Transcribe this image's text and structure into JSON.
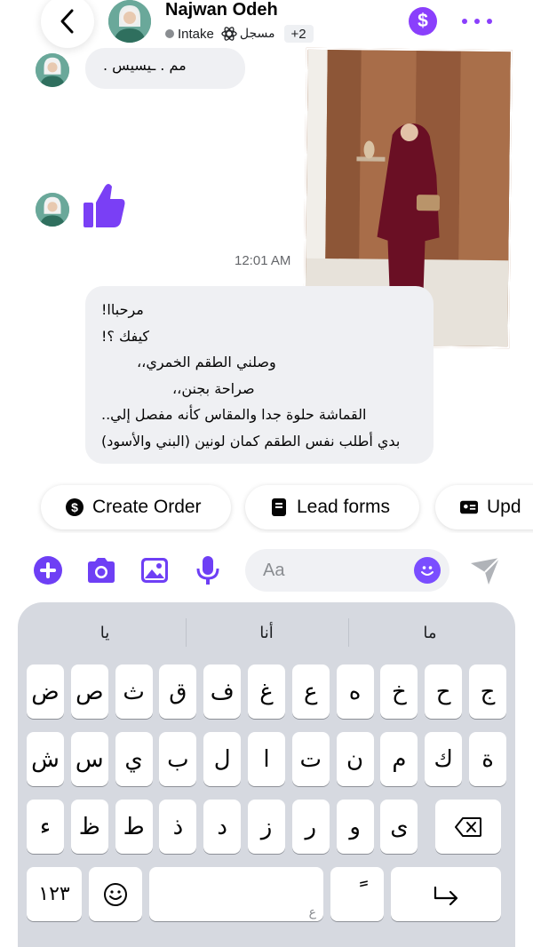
{
  "header": {
    "contact_name": "Najwan Odeh",
    "status_label": "Intake",
    "tag_label": "مسجل",
    "extra_tags": "+2",
    "dollar_glyph": "$"
  },
  "chat": {
    "top_bubble_text": "مم . ـيسيس .",
    "timestamp": "12:01 AM",
    "message_lines": [
      "مرحباا!",
      "كيفك ؟!",
      "وصلني الطقم الخمري،،",
      "صراحة بجنن،،",
      "القماشة حلوة جدا والمقاس كأنه مفصل إلي..",
      "بدي أطلب نفس الطقم كمان لونين (البني والأسود)"
    ]
  },
  "quick_actions": {
    "create_order": "Create Order",
    "lead_forms": "Lead forms",
    "update": "Upd"
  },
  "composer": {
    "placeholder": "Aa"
  },
  "keyboard": {
    "suggestions": [
      "يا",
      "أنا",
      "ما"
    ],
    "rows": [
      [
        "ض",
        "ص",
        "ث",
        "ق",
        "ف",
        "غ",
        "ع",
        "ه",
        "خ",
        "ح",
        "ج"
      ],
      [
        "ش",
        "س",
        "ي",
        "ب",
        "ل",
        "ا",
        "ت",
        "ن",
        "م",
        "ك",
        "ة"
      ],
      [
        "ء",
        "ظ",
        "ط",
        "ذ",
        "د",
        "ز",
        "ر",
        "و",
        "ى"
      ]
    ],
    "numbers_label": "١٢٣",
    "space_hint": "ع",
    "diacritic_label": "ً"
  },
  "colors": {
    "accent": "#8a3ffc",
    "brand_blue_purple": "#6e3ff5",
    "bubble_bg": "#eff0f3",
    "keyboard_bg": "#d6d9e0"
  }
}
